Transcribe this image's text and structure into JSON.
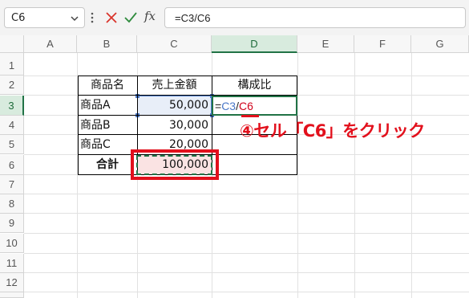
{
  "formula_bar": {
    "name_box": "C6",
    "fx_label": "fx",
    "formula": "=C3/C6"
  },
  "columns": [
    "A",
    "B",
    "C",
    "D",
    "E",
    "F",
    "G"
  ],
  "rows": [
    "1",
    "2",
    "3",
    "4",
    "5",
    "6",
    "7",
    "8",
    "9",
    "10",
    "11",
    "12"
  ],
  "table": {
    "headers": [
      "商品名",
      "売上金額",
      "構成比"
    ],
    "rows": [
      {
        "name": "商品A",
        "amount": "50,000"
      },
      {
        "name": "商品B",
        "amount": "30,000"
      },
      {
        "name": "商品C",
        "amount": "20,000"
      }
    ],
    "total_label": "合計",
    "total_amount": "100,000"
  },
  "editing_cell": {
    "eq": "=",
    "ref1": "C3",
    "slash": "/",
    "ref2": "C6"
  },
  "annotation": "④セル「C6」をクリック",
  "colors": {
    "ref1_blue": "#4a78c8",
    "ref2_red": "#d0021b",
    "highlight_red": "#e2101c",
    "excel_green": "#217346"
  }
}
